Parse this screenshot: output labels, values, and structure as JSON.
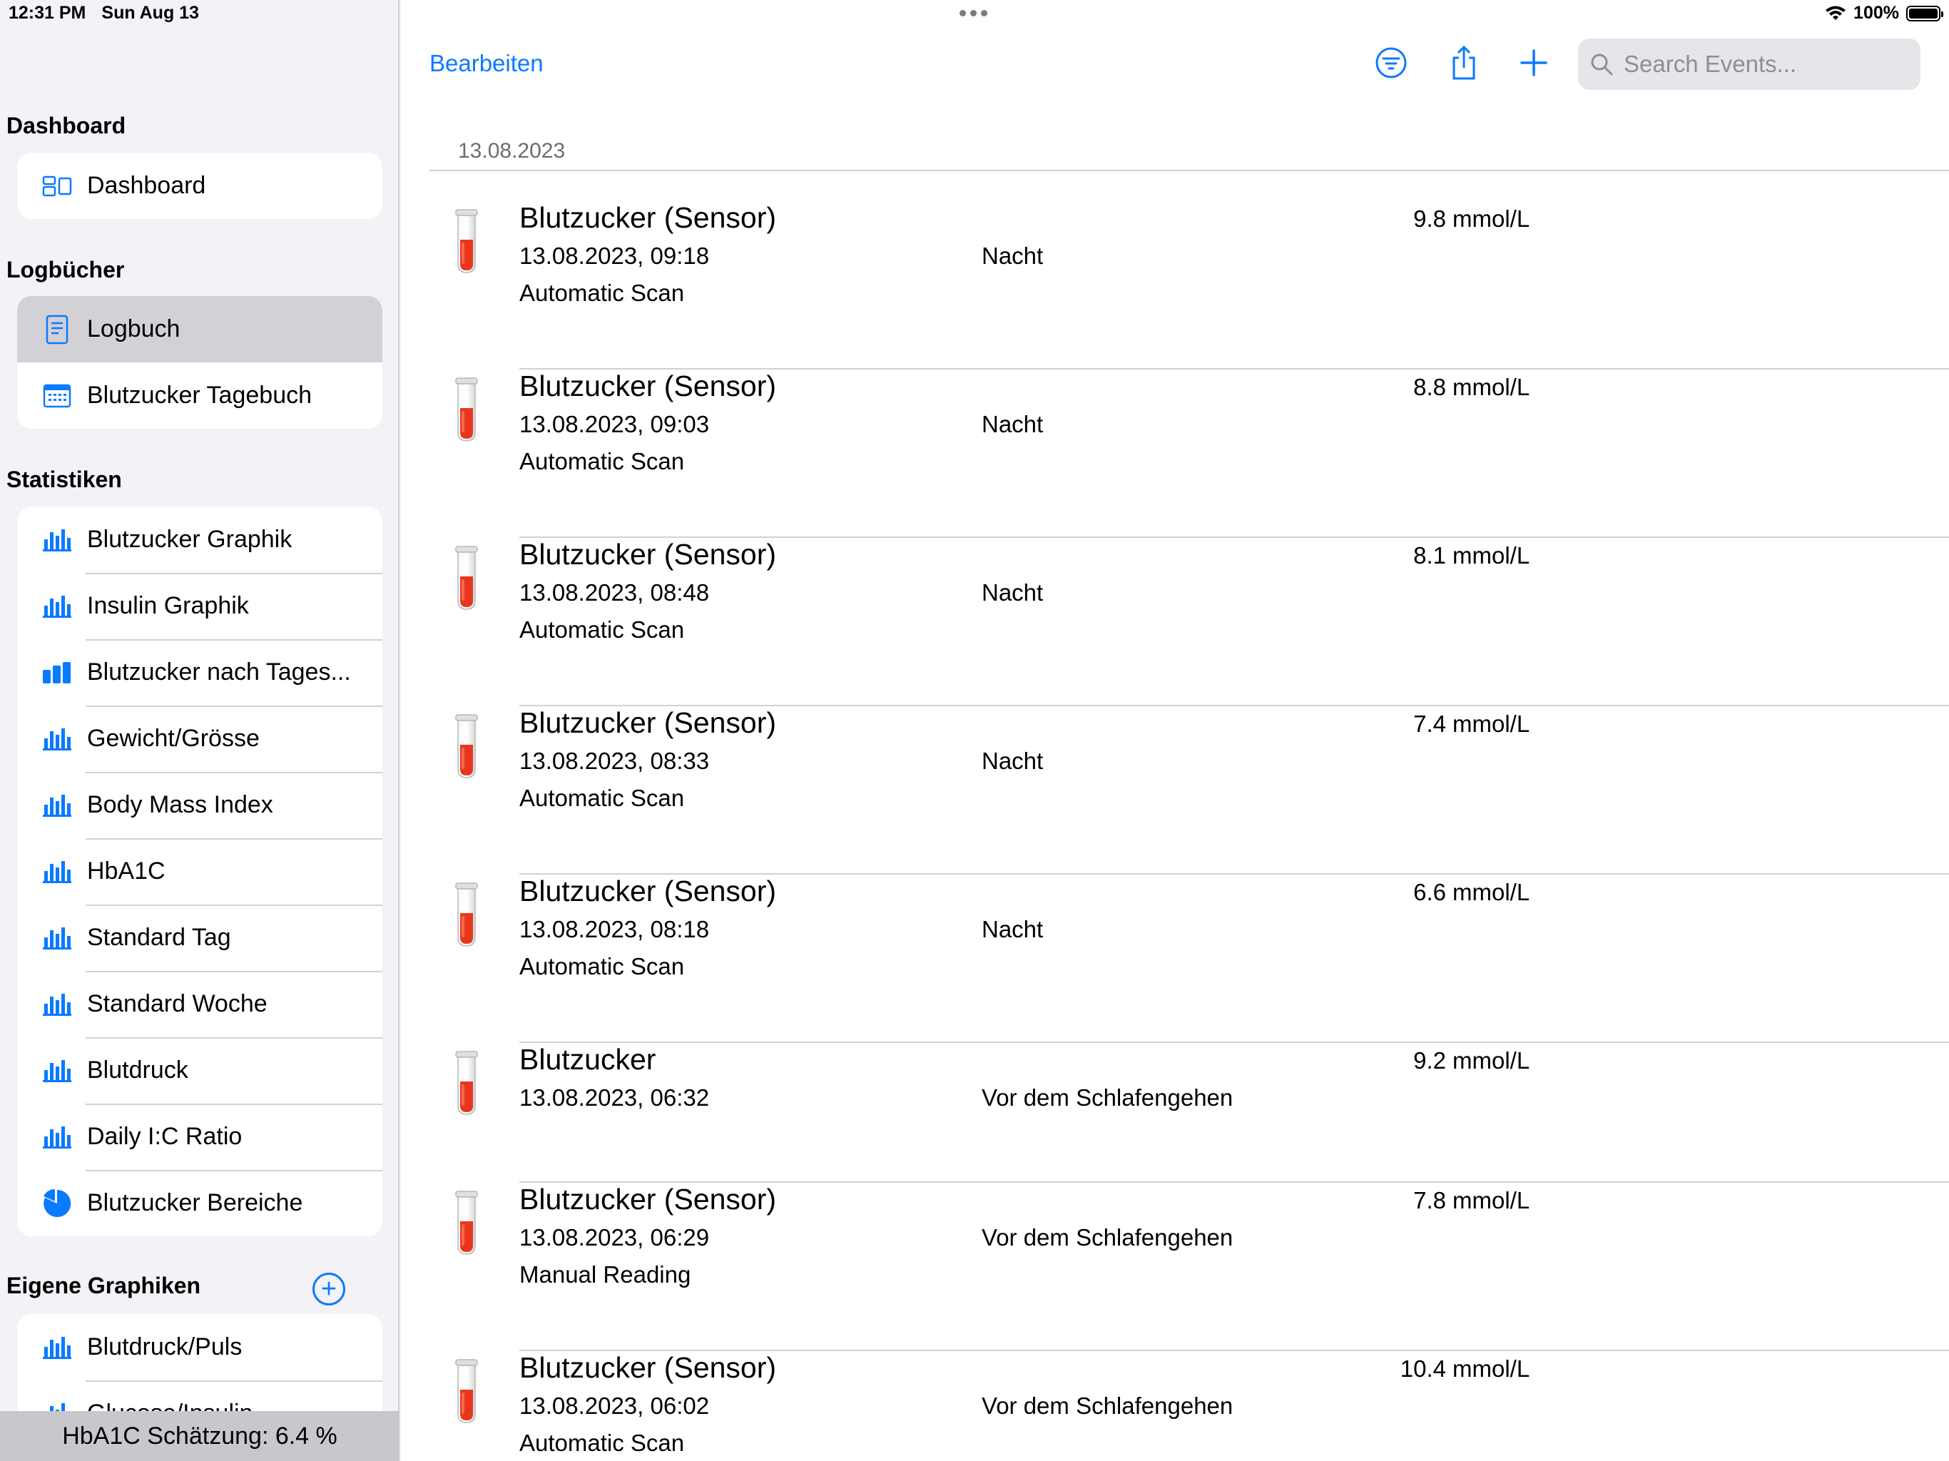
{
  "status": {
    "time": "12:31 PM",
    "date": "Sun Aug 13",
    "battery": "100%"
  },
  "sidebar": {
    "dashboard_header": "Dashboard",
    "dashboard_items": [
      {
        "label": "Dashboard",
        "icon": "dashboard-icon"
      }
    ],
    "logbooks_header": "Logbücher",
    "logbook_items": [
      {
        "label": "Logbuch",
        "icon": "document-icon",
        "selected": true
      },
      {
        "label": "Blutzucker Tagebuch",
        "icon": "calendar-icon"
      }
    ],
    "stats_header": "Statistiken",
    "stats_items": [
      {
        "label": "Blutzucker Graphik",
        "icon": "bar-chart-icon"
      },
      {
        "label": "Insulin Graphik",
        "icon": "bar-chart-icon"
      },
      {
        "label": "Blutzucker nach Tages...",
        "icon": "bar-chart-filled-icon"
      },
      {
        "label": "Gewicht/Grösse",
        "icon": "bar-chart-icon"
      },
      {
        "label": "Body Mass Index",
        "icon": "bar-chart-icon"
      },
      {
        "label": "HbA1C",
        "icon": "bar-chart-icon"
      },
      {
        "label": "Standard Tag",
        "icon": "bar-chart-icon"
      },
      {
        "label": "Standard Woche",
        "icon": "bar-chart-icon"
      },
      {
        "label": "Blutdruck",
        "icon": "bar-chart-icon"
      },
      {
        "label": "Daily I:C Ratio",
        "icon": "bar-chart-icon"
      },
      {
        "label": "Blutzucker Bereiche",
        "icon": "pie-chart-icon"
      }
    ],
    "custom_header": "Eigene Graphiken",
    "custom_items": [
      {
        "label": "Blutdruck/Puls",
        "icon": "bar-chart-icon"
      },
      {
        "label": "Glucose/Insulin",
        "icon": "bar-chart-icon"
      }
    ],
    "hba1c_estimate": "HbA1C Schätzung: 6.4 %"
  },
  "toolbar": {
    "edit_label": "Bearbeiten",
    "search_placeholder": "Search Events..."
  },
  "colors": {
    "accent": "#0a7aff",
    "tube_red": "#e8361e"
  },
  "log": {
    "date_header": "13.08.2023",
    "events": [
      {
        "title": "Blutzucker (Sensor)",
        "datetime": "13.08.2023, 09:18",
        "source": "Automatic Scan",
        "period": "Nacht",
        "value": "9.8",
        "unit": "mmol/L"
      },
      {
        "title": "Blutzucker (Sensor)",
        "datetime": "13.08.2023, 09:03",
        "source": "Automatic Scan",
        "period": "Nacht",
        "value": "8.8",
        "unit": "mmol/L"
      },
      {
        "title": "Blutzucker (Sensor)",
        "datetime": "13.08.2023, 08:48",
        "source": "Automatic Scan",
        "period": "Nacht",
        "value": "8.1",
        "unit": "mmol/L"
      },
      {
        "title": "Blutzucker (Sensor)",
        "datetime": "13.08.2023, 08:33",
        "source": "Automatic Scan",
        "period": "Nacht",
        "value": "7.4",
        "unit": "mmol/L"
      },
      {
        "title": "Blutzucker (Sensor)",
        "datetime": "13.08.2023, 08:18",
        "source": "Automatic Scan",
        "period": "Nacht",
        "value": "6.6",
        "unit": "mmol/L"
      },
      {
        "title": "Blutzucker",
        "datetime": "13.08.2023, 06:32",
        "source": "",
        "period": "Vor dem Schlafengehen",
        "value": "9.2",
        "unit": "mmol/L"
      },
      {
        "title": "Blutzucker (Sensor)",
        "datetime": "13.08.2023, 06:29",
        "source": "Manual Reading",
        "period": "Vor dem Schlafengehen",
        "value": "7.8",
        "unit": "mmol/L"
      },
      {
        "title": "Blutzucker (Sensor)",
        "datetime": "13.08.2023, 06:02",
        "source": "Automatic Scan",
        "period": "Vor dem Schlafengehen",
        "value": "10.4",
        "unit": "mmol/L"
      }
    ]
  }
}
